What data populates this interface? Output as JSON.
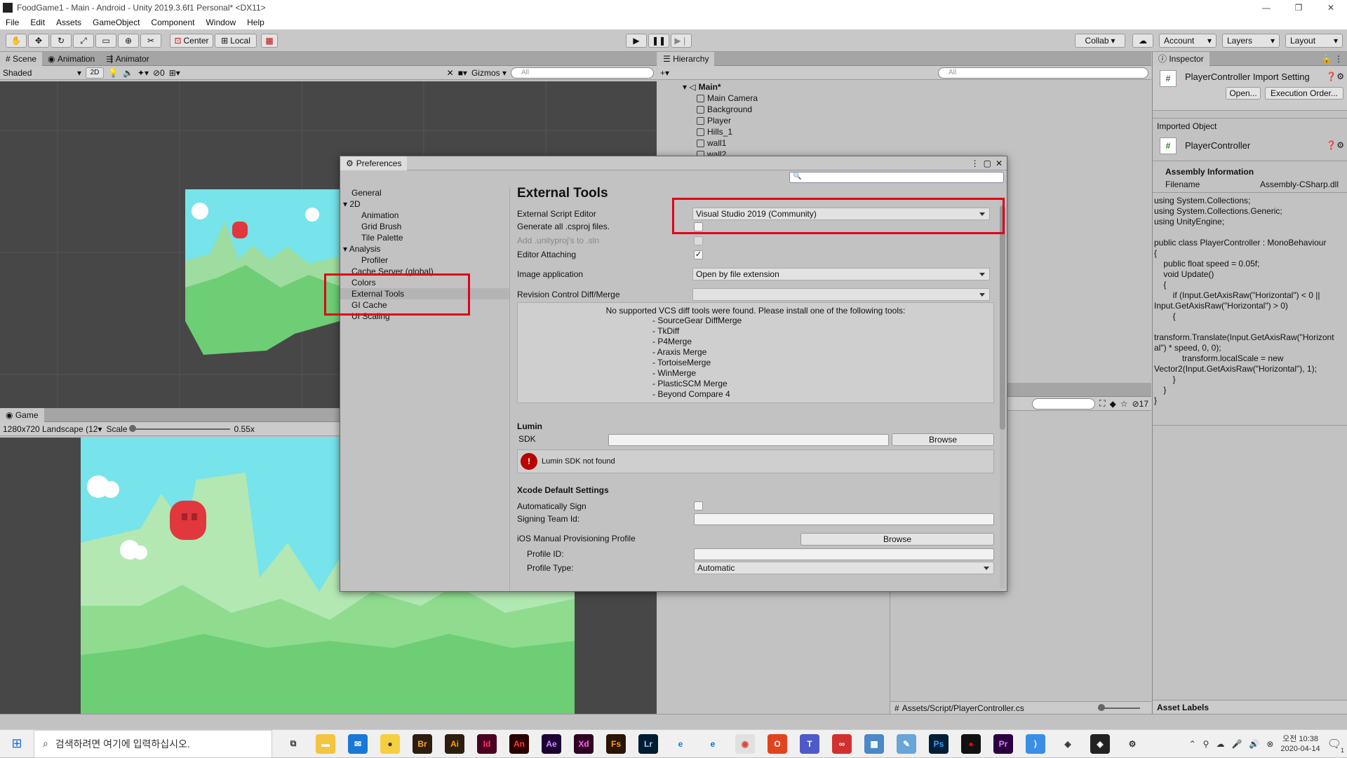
{
  "window": {
    "title": "FoodGame1 - Main - Android - Unity 2019.3.6f1 Personal* <DX11>"
  },
  "menu": [
    "File",
    "Edit",
    "Assets",
    "GameObject",
    "Component",
    "Window",
    "Help"
  ],
  "toolbar": {
    "center_label": "Center",
    "local_label": "Local",
    "collab_label": "Collab",
    "account_label": "Account",
    "layers_label": "Layers",
    "layout_label": "Layout"
  },
  "scene": {
    "tabs": [
      "Scene",
      "Animation",
      "Animator"
    ],
    "shading": "Shaded",
    "mode_2d": "2D",
    "hidden_count": "0",
    "gizmos": "Gizmos",
    "search_placeholder": "All"
  },
  "game": {
    "tab": "Game",
    "resolution": "1280x720 Landscape (12",
    "scale_label": "Scale",
    "scale_value": "0.55x"
  },
  "hierarchy": {
    "tab": "Hierarchy",
    "search_placeholder": "All",
    "scene_name": "Main*",
    "items": [
      "Main Camera",
      "Background",
      "Player",
      "Hills_1",
      "wall1",
      "wall2"
    ]
  },
  "project": {
    "path": "Assets/Script/PlayerController.cs",
    "count": "17"
  },
  "inspector": {
    "tab": "Inspector",
    "title": "PlayerController Import Setting",
    "open_label": "Open...",
    "exec_order_label": "Execution Order...",
    "imported_object": "Imported Object",
    "object_name": "PlayerController",
    "assembly_info": "Assembly Information",
    "filename_label": "Filename",
    "filename_value": "Assembly-CSharp.dll",
    "code": "using System.Collections;\nusing System.Collections.Generic;\nusing UnityEngine;\n\npublic class PlayerController : MonoBehaviour\n{\n    public float speed = 0.05f;\n    void Update()\n    {\n        if (Input.GetAxisRaw(\"Horizontal\") < 0 ||\nInput.GetAxisRaw(\"Horizontal\") > 0)\n        {\n\ntransform.Translate(Input.GetAxisRaw(\"Horizont\nal\") * speed, 0, 0);\n            transform.localScale = new\nVector2(Input.GetAxisRaw(\"Horizontal\"), 1);\n        }\n    }\n}",
    "asset_labels": "Asset Labels"
  },
  "prefs": {
    "title": "Preferences",
    "nav": {
      "general": "General",
      "2d": "2D",
      "animation": "Animation",
      "grid_brush": "Grid Brush",
      "tile_palette": "Tile Palette",
      "analysis": "Analysis",
      "profiler": "Profiler",
      "cache_server": "Cache Server (global)",
      "colors": "Colors",
      "external_tools": "External Tools",
      "gi_cache": "GI Cache",
      "ui_scaling": "UI Scaling"
    },
    "heading": "External Tools",
    "ext_editor_label": "External Script Editor",
    "ext_editor_value": "Visual Studio 2019 (Community)",
    "gen_csproj": "Generate all .csproj files.",
    "add_unityproj": "Add .unityproj's to .sln",
    "editor_attaching": "Editor Attaching",
    "image_app_label": "Image application",
    "image_app_value": "Open by file extension",
    "rev_control_label": "Revision Control Diff/Merge",
    "vcs_message": "No supported VCS diff tools were found. Please install one of the following tools:",
    "vcs_tools": [
      "- SourceGear DiffMerge",
      "- TkDiff",
      "- P4Merge",
      "- Araxis Merge",
      "- TortoiseMerge",
      "- WinMerge",
      "- PlasticSCM Merge",
      "- Beyond Compare 4"
    ],
    "lumin": "Lumin",
    "sdk": "SDK",
    "browse": "Browse",
    "lumin_error": "Lumin SDK not found",
    "xcode": "Xcode Default Settings",
    "auto_sign": "Automatically Sign",
    "team_id": "Signing Team Id:",
    "ios_profile": "iOS Manual Provisioning Profile",
    "profile_id": "Profile ID:",
    "profile_type": "Profile Type:",
    "profile_type_value": "Automatic"
  },
  "taskbar": {
    "search_placeholder": "검색하려면 여기에 입력하십시오.",
    "time_line1": "오전 10:38",
    "time_line2": "2020-04-14",
    "notif_count": "1"
  }
}
